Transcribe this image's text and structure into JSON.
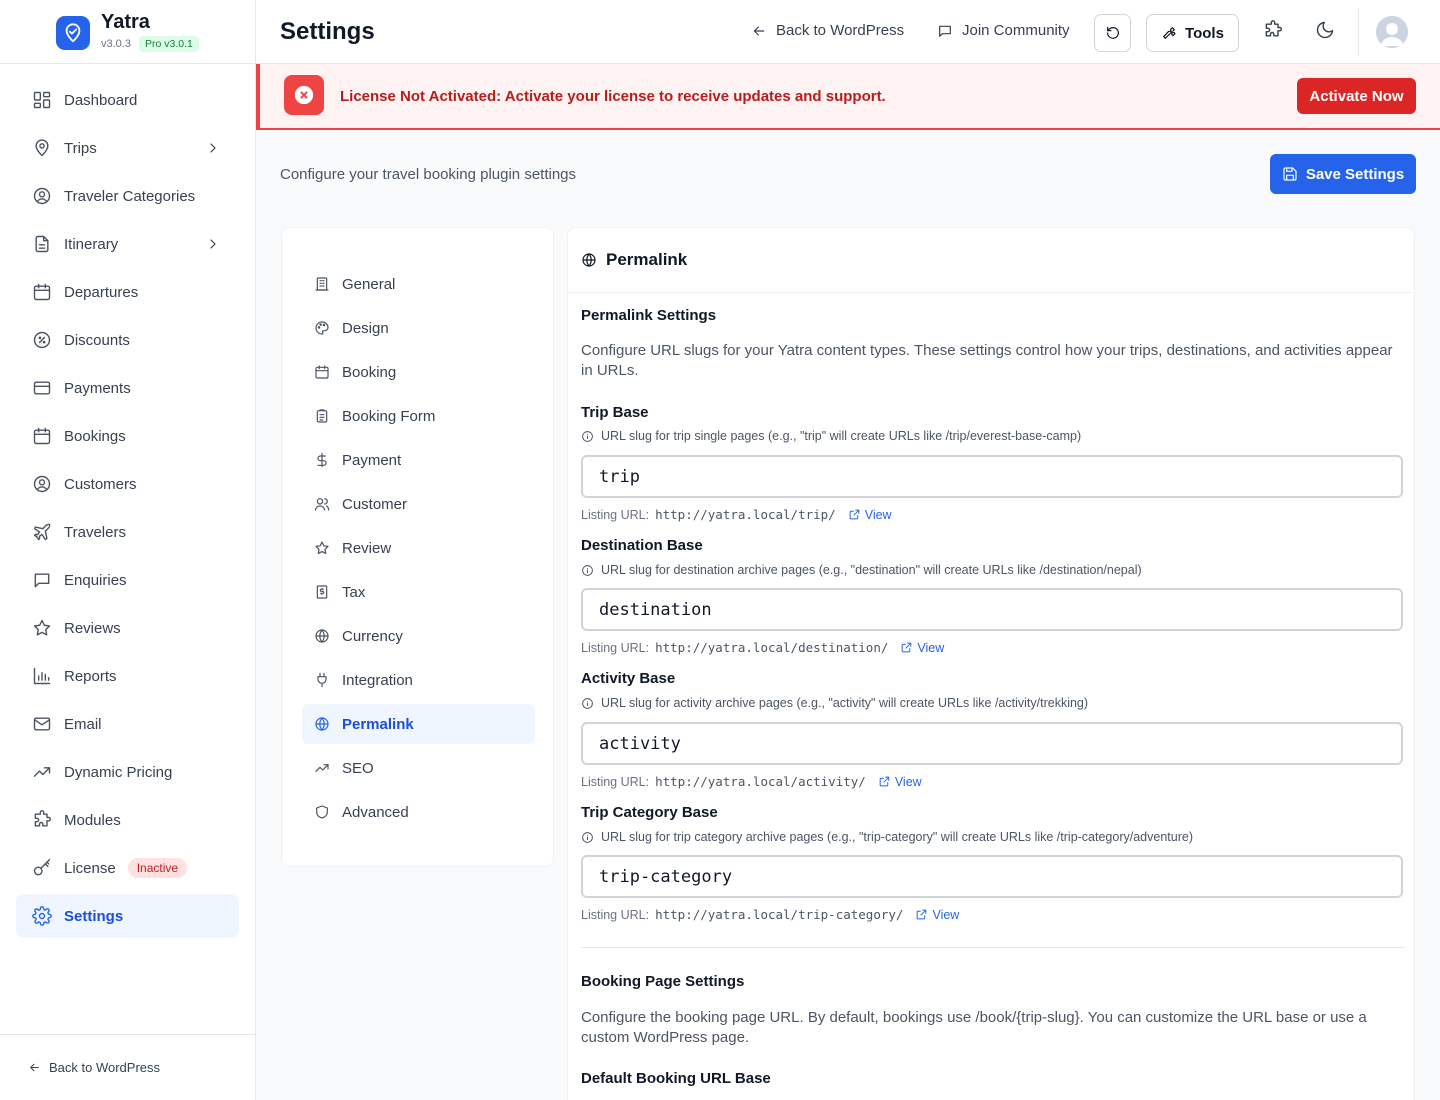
{
  "brand": {
    "name": "Yatra",
    "version": "v3.0.3",
    "pro_badge": "Pro v3.0.1",
    "accent": "#2563eb"
  },
  "sidebar": {
    "items": [
      {
        "label": "Dashboard"
      },
      {
        "label": "Trips"
      },
      {
        "label": "Traveler Categories"
      },
      {
        "label": "Itinerary"
      },
      {
        "label": "Departures"
      },
      {
        "label": "Discounts"
      },
      {
        "label": "Payments"
      },
      {
        "label": "Bookings"
      },
      {
        "label": "Customers"
      },
      {
        "label": "Travelers"
      },
      {
        "label": "Enquiries"
      },
      {
        "label": "Reviews"
      },
      {
        "label": "Reports"
      },
      {
        "label": "Email"
      },
      {
        "label": "Dynamic Pricing"
      },
      {
        "label": "Modules"
      },
      {
        "label": "License",
        "badge": "Inactive"
      },
      {
        "label": "Settings",
        "active": true
      }
    ],
    "footer_link": "Back to WordPress"
  },
  "header": {
    "title": "Settings",
    "back_link": "Back to WordPress",
    "community_link": "Join Community",
    "tools_button": "Tools"
  },
  "alert": {
    "title": "License Not Activated:",
    "message": "Activate your license to receive updates and support.",
    "button": "Activate Now",
    "color": "#dc2626"
  },
  "page": {
    "subtitle": "Configure your travel booking plugin settings",
    "save_button": "Save Settings"
  },
  "settings_nav": {
    "items": [
      {
        "label": "General"
      },
      {
        "label": "Design"
      },
      {
        "label": "Booking"
      },
      {
        "label": "Booking Form"
      },
      {
        "label": "Payment"
      },
      {
        "label": "Customer"
      },
      {
        "label": "Review"
      },
      {
        "label": "Tax"
      },
      {
        "label": "Currency"
      },
      {
        "label": "Integration"
      },
      {
        "label": "Permalink",
        "active": true
      },
      {
        "label": "SEO"
      },
      {
        "label": "Advanced"
      }
    ]
  },
  "panel": {
    "title": "Permalink",
    "section_title": "Permalink Settings",
    "section_desc": "Configure URL slugs for your Yatra content types. These settings control how your trips, destinations, and activities appear in URLs.",
    "listing_label": "Listing URL:",
    "view_label": "View",
    "fields": [
      {
        "label": "Trip Base",
        "help": "URL slug for trip single pages (e.g., \"trip\" will create URLs like /trip/everest-base-camp)",
        "value": "trip",
        "url": "http://yatra.local/trip/"
      },
      {
        "label": "Destination Base",
        "help": "URL slug for destination archive pages (e.g., \"destination\" will create URLs like /destination/nepal)",
        "value": "destination",
        "url": "http://yatra.local/destination/"
      },
      {
        "label": "Activity Base",
        "help": "URL slug for activity archive pages (e.g., \"activity\" will create URLs like /activity/trekking)",
        "value": "activity",
        "url": "http://yatra.local/activity/"
      },
      {
        "label": "Trip Category Base",
        "help": "URL slug for trip category archive pages (e.g., \"trip-category\" will create URLs like /trip-category/adventure)",
        "value": "trip-category",
        "url": "http://yatra.local/trip-category/"
      }
    ],
    "booking_section_title": "Booking Page Settings",
    "booking_section_desc": "Configure the booking page URL. By default, bookings use /book/{trip-slug}. You can customize the URL base or use a custom WordPress page.",
    "booking_field_label": "Default Booking URL Base"
  }
}
